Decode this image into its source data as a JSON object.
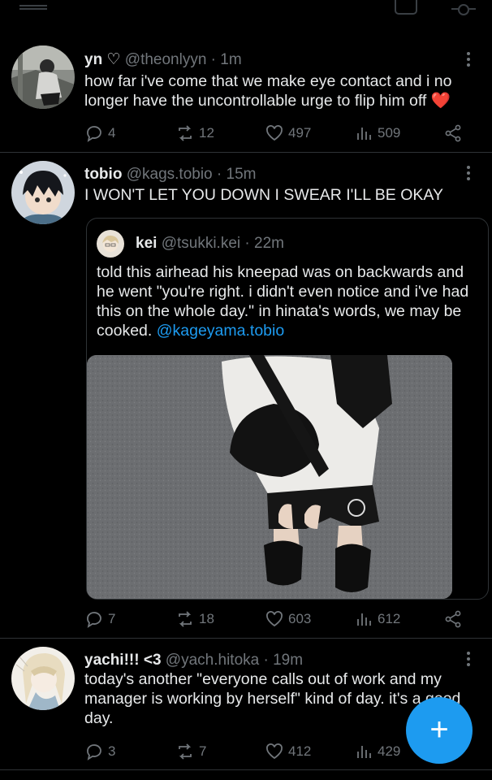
{
  "icons": {
    "reply": "reply-icon",
    "retweet": "retweet-icon",
    "like": "heart-icon",
    "views": "views-icon",
    "share": "share-icon",
    "more": "more-icon",
    "compose": "compose-icon"
  },
  "colors": {
    "background": "#000000",
    "accent": "#1d9bf0",
    "muted": "#71767b",
    "heart_emoji": "#e0245e"
  },
  "tweets": [
    {
      "name": "yn",
      "name_suffix": " ♡",
      "handle": "@theonlyyn · 1m",
      "text": "how far i've come that we make eye contact and i no longer have the uncontrollable urge to flip him off",
      "emoji": "❤️",
      "replies": "4",
      "retweets": "12",
      "likes": "497",
      "views": "509"
    },
    {
      "name": "tobio",
      "handle": "@kags.tobio · 15m",
      "text": "I WON'T LET YOU DOWN I SWEAR I'LL BE OKAY",
      "quote": {
        "name": "kei",
        "handle": "@tsukki.kei · 22m",
        "text": "told this airhead his kneepad was on backwards and he went \"you're right. i didn't even notice and i've had this on the whole day.\" in hinata's words, we may be cooked. ",
        "mention": "@kageyama.tobio"
      },
      "replies": "7",
      "retweets": "18",
      "likes": "603",
      "views": "612"
    },
    {
      "name": "yachi!!! <3",
      "handle": "@yach.hitoka · 19m",
      "text": "today's another \"everyone calls out of work and my manager is working by herself\" kind of day. it's a good day.",
      "replies": "3",
      "retweets": "7",
      "likes": "412",
      "views": "429"
    }
  ],
  "fab": {
    "label": "+"
  }
}
